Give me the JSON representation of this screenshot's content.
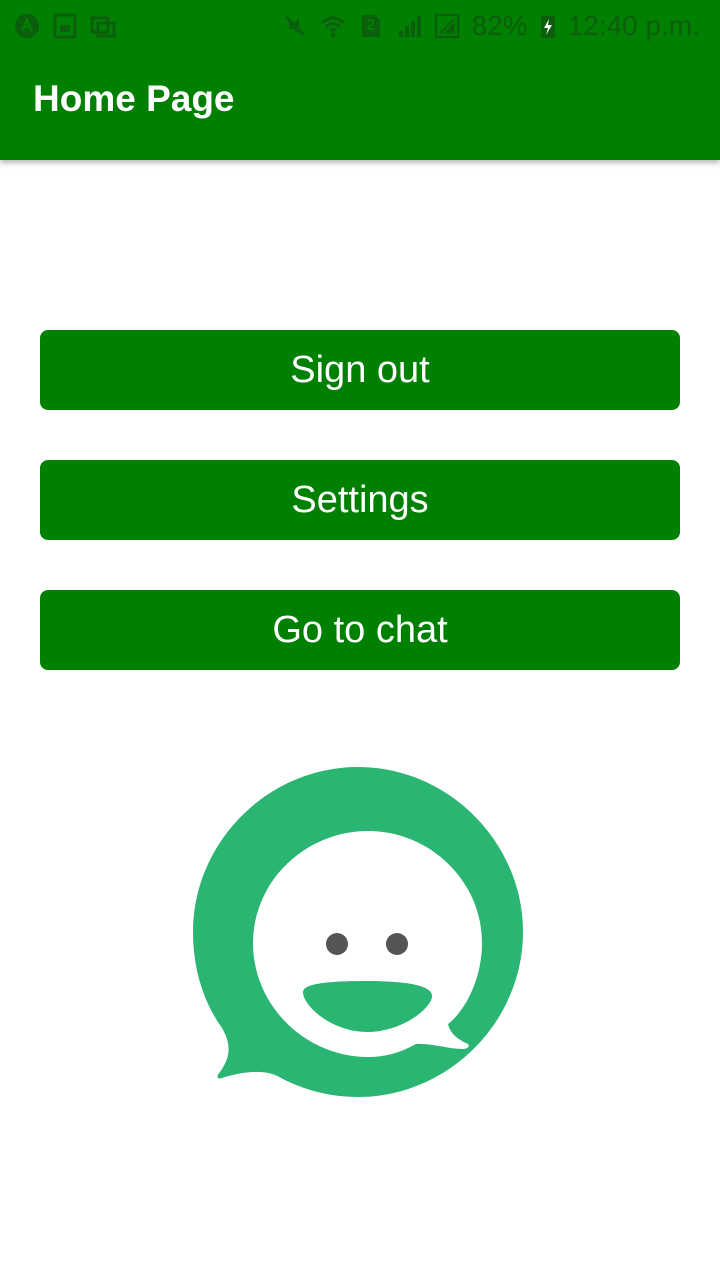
{
  "status_bar": {
    "battery_percent": "82%",
    "time": "12:40 p.m.",
    "sim_slot": "2",
    "icons_left": [
      "android-icon",
      "image-icon",
      "gallery-icon"
    ],
    "icons_right": [
      "mute-icon",
      "wifi-icon",
      "sim-icon",
      "signal-icon",
      "no-signal-icon",
      "battery-charging-icon"
    ]
  },
  "app_bar": {
    "title": "Home Page"
  },
  "buttons": {
    "sign_out": "Sign out",
    "settings": "Settings",
    "go_to_chat": "Go to chat"
  },
  "logo": {
    "icon": "chat-smiley-logo-icon",
    "color": "#2ab573"
  },
  "colors": {
    "primary": "#008000",
    "button_text": "#ffffff"
  }
}
